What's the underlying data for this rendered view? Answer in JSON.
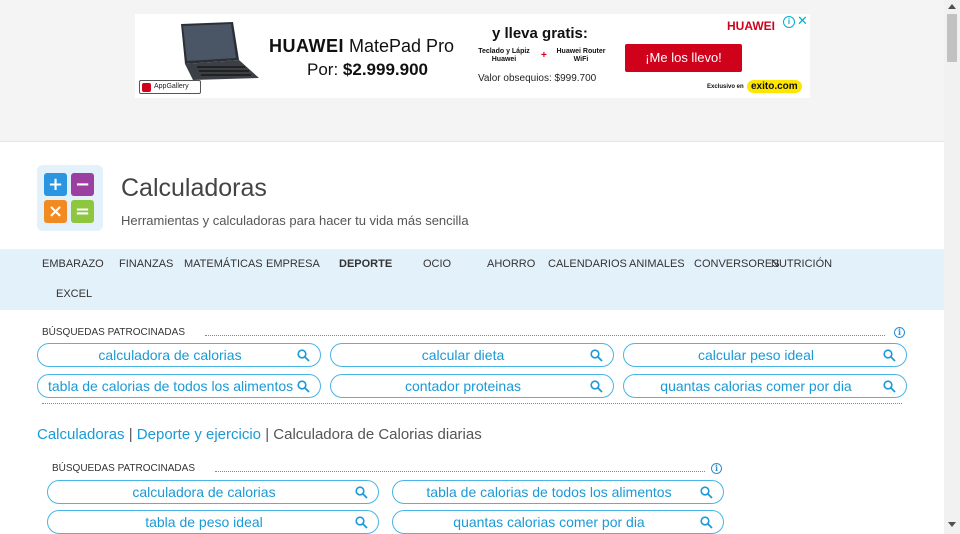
{
  "ad": {
    "product_brand": "HUAWEI",
    "product_name": "MatePad Pro",
    "price_label": "Por:",
    "price": "$2.999.900",
    "gift_title": "y lleva gratis:",
    "gift_item_1": "Teclado y Lápiz Huawei",
    "plus": "+",
    "gift_item_2": "Huawei Router WiFi",
    "gift_value": "Valor obsequios: $999.700",
    "cta": "¡Me los llevo!",
    "brand_logo": "HUAWEI",
    "appgallery": "AppGallery",
    "exclusive": "Exclusivo en",
    "retailer": "exito.com",
    "close": "✕",
    "choices": "i",
    "colors": {
      "accent": "#d0021b",
      "retailer": "#ffe600"
    }
  },
  "site": {
    "title": "Calculadoras",
    "tagline": "Herramientas y calculadoras para hacer tu vida más sencilla",
    "logo": {
      "plus": "+",
      "minus": "−",
      "times": "×",
      "equals": "=",
      "colors": [
        "#2a95e0",
        "#9b3fa0",
        "#f28a22",
        "#8ec63f"
      ]
    }
  },
  "nav": {
    "items": [
      {
        "label": "EMBARAZO"
      },
      {
        "label": "FINANZAS"
      },
      {
        "label": "MATEMÁTICAS"
      },
      {
        "label": "EMPRESA"
      },
      {
        "label": "DEPORTE",
        "active": true
      },
      {
        "label": "OCIO"
      },
      {
        "label": "AHORRO"
      },
      {
        "label": "CALENDARIOS"
      },
      {
        "label": "ANIMALES"
      },
      {
        "label": "CONVERSORES"
      },
      {
        "label": "NUTRICIÓN"
      },
      {
        "label": "EXCEL"
      }
    ]
  },
  "sponsored_top": {
    "label": "BÚSQUEDAS PATROCINADAS",
    "info_icon": "info-icon",
    "pills": [
      {
        "text": "calculadora de calorias"
      },
      {
        "text": "calcular dieta"
      },
      {
        "text": "calcular peso ideal"
      },
      {
        "text": "tabla de calorias de todos los alimentos"
      },
      {
        "text": "contador proteinas"
      },
      {
        "text": "quantas calorias comer por dia"
      }
    ]
  },
  "breadcrumb": {
    "home": "Calculadoras",
    "sep1": "|",
    "category": "Deporte y ejercicio",
    "sep2": "|",
    "current": "Calculadora de Calorias diarias"
  },
  "sponsored_bottom": {
    "label": "BÚSQUEDAS PATROCINADAS",
    "info_icon": "info-icon",
    "pills": [
      {
        "text": "calculadora de calorias"
      },
      {
        "text": "tabla de calorias de todos los alimentos"
      },
      {
        "text": "tabla de peso ideal"
      },
      {
        "text": "quantas calorias comer por dia"
      }
    ]
  },
  "colors": {
    "link": "#1a9ad6",
    "pill_border": "#49b4e6",
    "nav_bg": "#e3f1fb"
  }
}
